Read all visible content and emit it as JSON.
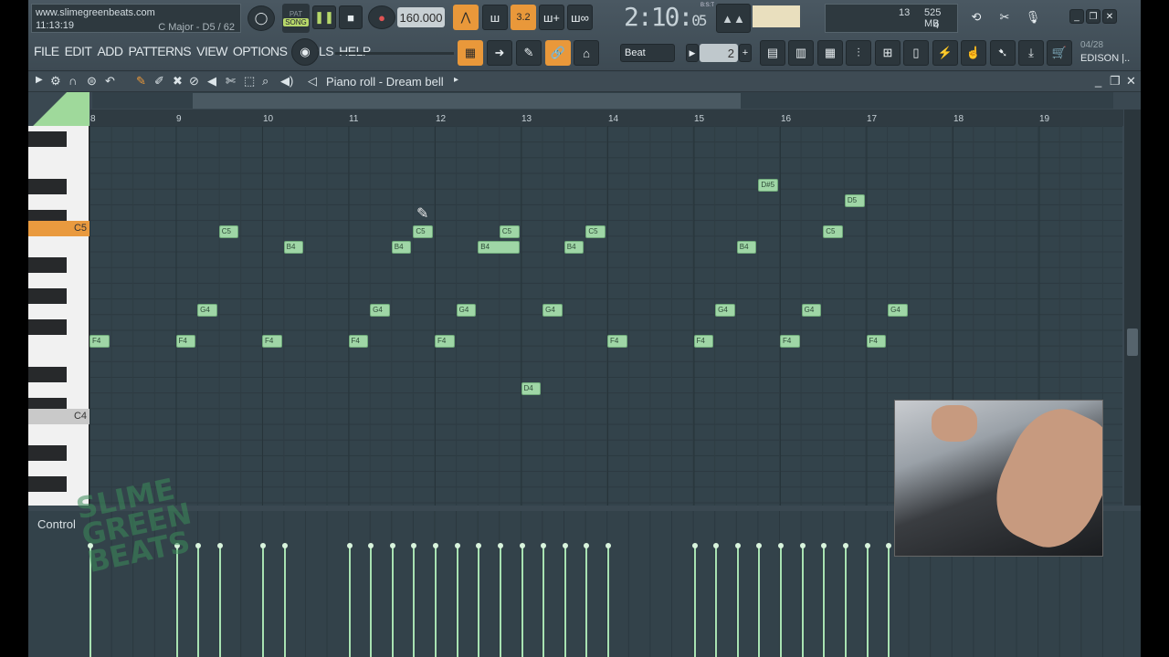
{
  "hint": {
    "url": "www.slimegreenbeats.com",
    "time": "11:13:19",
    "key_info": "C Major - D5 / 62"
  },
  "transport": {
    "pat": "PAT",
    "song": "SONG",
    "tempo": "160.000",
    "time_signature": "3.2",
    "clock_main": "2:10",
    "clock_sub": "05",
    "bst": "B:S:T"
  },
  "memory": {
    "value1": "13",
    "ram": "525 MB",
    "value2": "4"
  },
  "menu": [
    "FILE",
    "EDIT",
    "ADD",
    "PATTERNS",
    "VIEW",
    "OPTIONS",
    "TOOLS",
    "HELP"
  ],
  "snap": {
    "label": "Beat",
    "value": "2"
  },
  "plugin": {
    "date": "04/28",
    "name": "EDISON |.."
  },
  "piano_roll": {
    "title": "Piano roll - Dream bell"
  },
  "timeline": [
    "8",
    "9",
    "10",
    "11",
    "12",
    "13",
    "14",
    "15",
    "16",
    "17",
    "18",
    "19"
  ],
  "keys": {
    "c5": "C5",
    "c4": "C4"
  },
  "notes": [
    {
      "label": "F4",
      "bar": 8.0,
      "len": 0.25,
      "row": "F4"
    },
    {
      "label": "F4",
      "bar": 9.0,
      "len": 0.25,
      "row": "F4"
    },
    {
      "label": "G4",
      "bar": 9.25,
      "len": 0.25,
      "row": "G4"
    },
    {
      "label": "C5",
      "bar": 9.5,
      "len": 0.25,
      "row": "C5"
    },
    {
      "label": "F4",
      "bar": 10.0,
      "len": 0.25,
      "row": "F4"
    },
    {
      "label": "B4",
      "bar": 10.25,
      "len": 0.25,
      "row": "B4"
    },
    {
      "label": "F4",
      "bar": 11.0,
      "len": 0.25,
      "row": "F4"
    },
    {
      "label": "G4",
      "bar": 11.25,
      "len": 0.25,
      "row": "G4"
    },
    {
      "label": "B4",
      "bar": 11.5,
      "len": 0.25,
      "row": "B4"
    },
    {
      "label": "C5",
      "bar": 11.75,
      "len": 0.25,
      "row": "C5"
    },
    {
      "label": "F4",
      "bar": 12.0,
      "len": 0.25,
      "row": "F4"
    },
    {
      "label": "G4",
      "bar": 12.25,
      "len": 0.25,
      "row": "G4"
    },
    {
      "label": "B4",
      "bar": 12.5,
      "len": 0.5,
      "row": "B4"
    },
    {
      "label": "C5",
      "bar": 12.75,
      "len": 0.25,
      "row": "C5"
    },
    {
      "label": "D4",
      "bar": 13.0,
      "len": 0.25,
      "row": "D4"
    },
    {
      "label": "G4",
      "bar": 13.25,
      "len": 0.25,
      "row": "G4"
    },
    {
      "label": "B4",
      "bar": 13.5,
      "len": 0.25,
      "row": "B4"
    },
    {
      "label": "C5",
      "bar": 13.75,
      "len": 0.25,
      "row": "C5"
    },
    {
      "label": "F4",
      "bar": 14.0,
      "len": 0.25,
      "row": "F4"
    },
    {
      "label": "F4",
      "bar": 15.0,
      "len": 0.25,
      "row": "F4"
    },
    {
      "label": "G4",
      "bar": 15.25,
      "len": 0.25,
      "row": "G4"
    },
    {
      "label": "B4",
      "bar": 15.5,
      "len": 0.25,
      "row": "B4"
    },
    {
      "label": "D#5",
      "bar": 15.75,
      "len": 0.25,
      "row": "D#5"
    },
    {
      "label": "F4",
      "bar": 16.0,
      "len": 0.25,
      "row": "F4"
    },
    {
      "label": "G4",
      "bar": 16.25,
      "len": 0.25,
      "row": "G4"
    },
    {
      "label": "C5",
      "bar": 16.5,
      "len": 0.25,
      "row": "C5"
    },
    {
      "label": "D5",
      "bar": 16.75,
      "len": 0.25,
      "row": "D5"
    },
    {
      "label": "F4",
      "bar": 17.0,
      "len": 0.25,
      "row": "F4"
    },
    {
      "label": "G4",
      "bar": 17.25,
      "len": 0.25,
      "row": "G4"
    }
  ],
  "control": {
    "label": "Control"
  },
  "watermark": {
    "line1": "SLIME",
    "line2": "GREEN",
    "line3": "BEATS"
  },
  "colors": {
    "note": "#9fd6a6",
    "accent": "#e9983a",
    "bg": "#3a4851"
  }
}
